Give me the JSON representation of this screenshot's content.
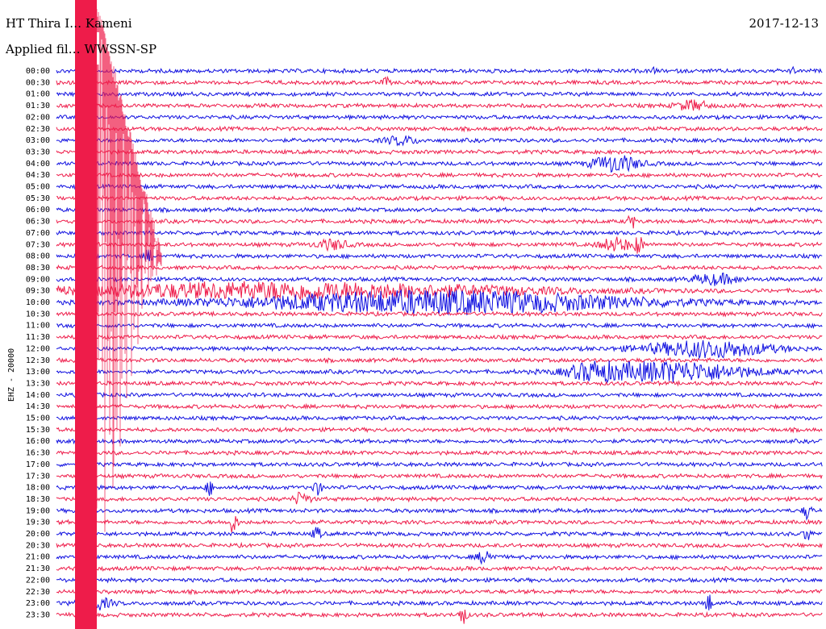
{
  "header": {
    "station": "HT Thira I… Kameni",
    "date": "2017-12-13",
    "filter": "Applied fil… WWSSN-SP"
  },
  "chart_data": {
    "type": "line",
    "title": "HT Thira … Kameni",
    "ylabel": "EHZ - 20000",
    "ticks": [
      "00:00",
      "00:30",
      "01:00",
      "01:30",
      "02:00",
      "02:30",
      "03:00",
      "03:30",
      "04:00",
      "04:30",
      "05:00",
      "05:30",
      "06:00",
      "06:30",
      "07:00",
      "07:30",
      "08:00",
      "08:30",
      "09:00",
      "09:30",
      "10:00",
      "10:30",
      "11:00",
      "11:30",
      "12:00",
      "12:30",
      "13:00",
      "13:30",
      "14:00",
      "14:30",
      "15:00",
      "15:30",
      "16:00",
      "16:30",
      "17:00",
      "17:30",
      "18:00",
      "18:30",
      "19:00",
      "19:30",
      "20:00",
      "20:30",
      "21:00",
      "21:30",
      "22:00",
      "22:30",
      "23:00",
      "23:30"
    ],
    "trace_colors": [
      "#1010e0",
      "#ee1c4a"
    ],
    "events": [
      {
        "row": 0,
        "x": 0.78,
        "amp": 4,
        "width": 0.003
      },
      {
        "row": 0,
        "x": 0.96,
        "amp": 4,
        "width": 0.003
      },
      {
        "row": 1,
        "x": 0.43,
        "amp": 6,
        "width": 0.004
      },
      {
        "row": 3,
        "x": 0.83,
        "amp": 6,
        "width": 0.02
      },
      {
        "row": 6,
        "x": 0.45,
        "amp": 5,
        "width": 0.02
      },
      {
        "row": 8,
        "x": 0.73,
        "amp": 10,
        "width": 0.03
      },
      {
        "row": 13,
        "x": 0.75,
        "amp": 12,
        "width": 0.004
      },
      {
        "row": 15,
        "x": 0.36,
        "amp": 6,
        "width": 0.02
      },
      {
        "row": 15,
        "x": 0.73,
        "amp": 8,
        "width": 0.02
      },
      {
        "row": 15,
        "x": 0.76,
        "amp": 12,
        "width": 0.005
      },
      {
        "row": 16,
        "x": 0.12,
        "amp": 8,
        "width": 0.005
      },
      {
        "row": 18,
        "x": 0.86,
        "amp": 6,
        "width": 0.03
      },
      {
        "row": 19,
        "x": 0.3,
        "amp": 10,
        "width": 0.3
      },
      {
        "row": 20,
        "x": 0.5,
        "amp": 14,
        "width": 0.25
      },
      {
        "row": 24,
        "x": 0.85,
        "amp": 10,
        "width": 0.08
      },
      {
        "row": 26,
        "x": 0.8,
        "amp": 12,
        "width": 0.1
      },
      {
        "row": 26,
        "x": 0.7,
        "amp": 8,
        "width": 0.03
      },
      {
        "row": 36,
        "x": 0.2,
        "amp": 8,
        "width": 0.005
      },
      {
        "row": 36,
        "x": 0.34,
        "amp": 8,
        "width": 0.006
      },
      {
        "row": 37,
        "x": 0.32,
        "amp": 8,
        "width": 0.01
      },
      {
        "row": 38,
        "x": 0.98,
        "amp": 10,
        "width": 0.005
      },
      {
        "row": 39,
        "x": 0.23,
        "amp": 12,
        "width": 0.006
      },
      {
        "row": 40,
        "x": 0.34,
        "amp": 8,
        "width": 0.005
      },
      {
        "row": 40,
        "x": 0.98,
        "amp": 10,
        "width": 0.004
      },
      {
        "row": 42,
        "x": 0.56,
        "amp": 8,
        "width": 0.01
      },
      {
        "row": 46,
        "x": 0.05,
        "amp": 8,
        "width": 0.02
      },
      {
        "row": 46,
        "x": 0.85,
        "amp": 12,
        "width": 0.005
      },
      {
        "row": 47,
        "x": 0.53,
        "amp": 12,
        "width": 0.005
      }
    ],
    "main_quake": {
      "x": 0.02,
      "decay_rows": 16
    }
  }
}
